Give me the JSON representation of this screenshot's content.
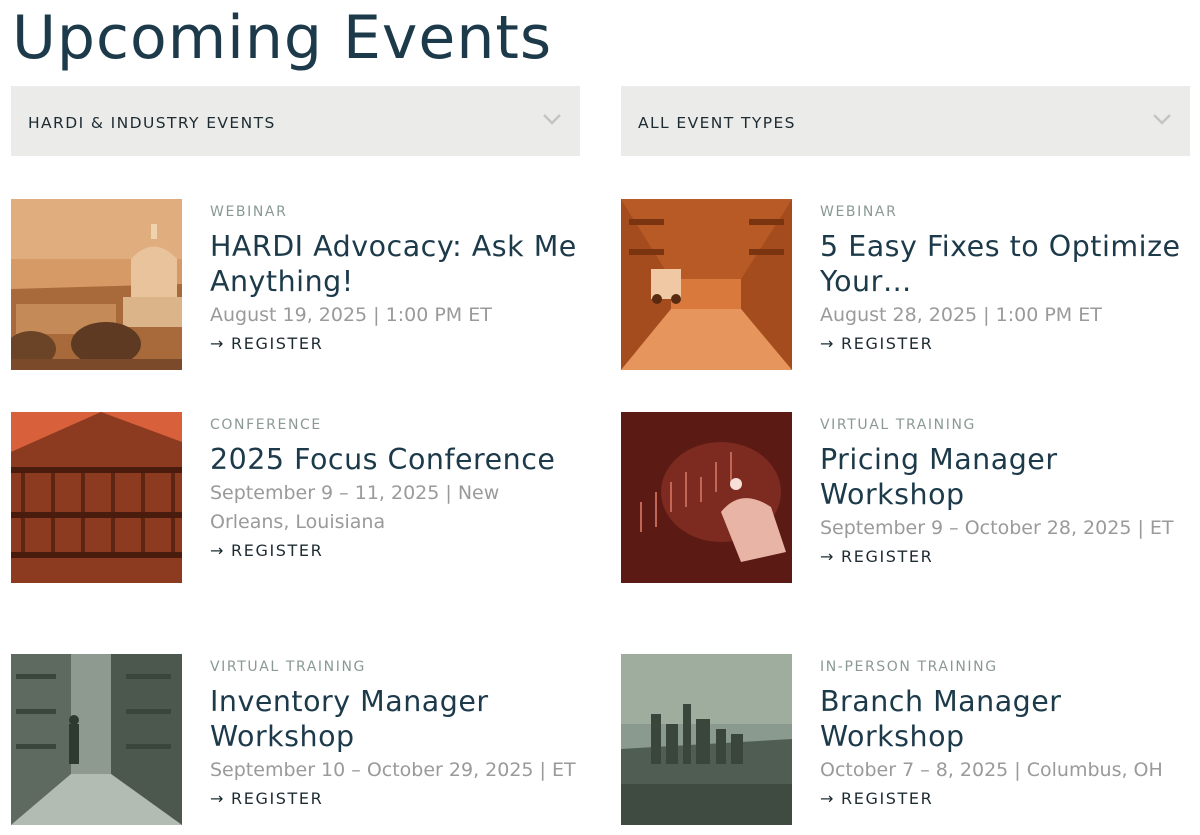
{
  "page": {
    "title": "Upcoming Events"
  },
  "filters": [
    {
      "label": "HARDI & INDUSTRY EVENTS",
      "icon": "chevron-down-icon"
    },
    {
      "label": "ALL EVENT TYPES",
      "icon": "chevron-down-icon"
    }
  ],
  "register_label": "REGISTER",
  "arrow_glyph": "→",
  "events": [
    {
      "type": "WEBINAR",
      "title": "HARDI Advocacy: Ask Me Anything!",
      "date": "August 19, 2025 | 1:00 PM ET",
      "image": "capitol-building-photo",
      "tint": "#d18a4f"
    },
    {
      "type": "WEBINAR",
      "title": "5 Easy Fixes to Optimize Your…",
      "date": "August 28, 2025 | 1:00 PM ET",
      "image": "warehouse-forklift-photo",
      "tint": "#d9773b"
    },
    {
      "type": "CONFERENCE",
      "title": "2025 Focus Conference",
      "date": "September 9 – 11, 2025 | New Orleans, Louisiana",
      "image": "new-orleans-balcony-photo",
      "tint": "#c2542f"
    },
    {
      "type": "VIRTUAL TRAINING",
      "title": "Pricing Manager Workshop",
      "date": "September 9 – October 28, 2025 | ET",
      "image": "stock-chart-hand-photo",
      "tint": "#8a2c22"
    },
    {
      "type": "VIRTUAL TRAINING",
      "title": "Inventory Manager Workshop",
      "date": "September 10 – October 29, 2025 | ET",
      "image": "warehouse-aisle-photo",
      "tint": "#7f8c80"
    },
    {
      "type": "IN-PERSON TRAINING",
      "title": "Branch Manager Workshop",
      "date": "October 7 – 8, 2025 | Columbus, OH",
      "image": "columbus-skyline-photo",
      "tint": "#6e8075"
    }
  ]
}
